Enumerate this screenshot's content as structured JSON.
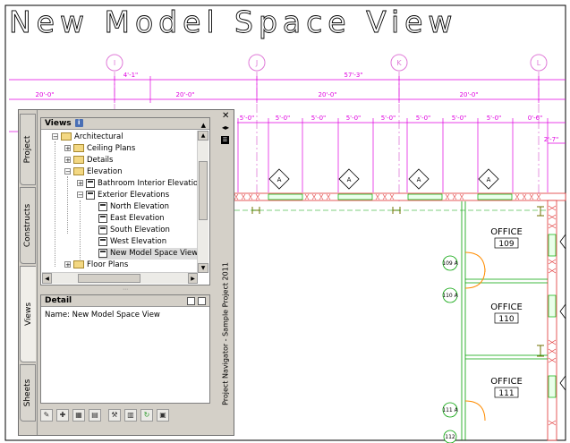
{
  "drawing": {
    "view_title": "New Model Space View",
    "grid_bubbles": [
      "I",
      "J",
      "K",
      "L"
    ],
    "dimensions_top": [
      "4'-1\"",
      "57'-3\""
    ],
    "dimensions_mid": [
      "20'-0\"",
      "20'-0\"",
      "20'-0\"",
      "20'-0\""
    ],
    "dimensions_small": [
      "5'-0\"",
      "5'-0\"",
      "5'-0\"",
      "5'-0\"",
      "5'-0\"",
      "5'-0\"",
      "5'-0\"",
      "5'-0\"",
      "5'-0\"",
      "5'-0\"",
      "5'-0\"",
      "5'-0\"",
      "0'-6\""
    ],
    "dimension_right": "2'-7\"",
    "window_tags": [
      "A",
      "A",
      "A",
      "A"
    ],
    "rooms": [
      {
        "name": "OFFICE",
        "number": "109"
      },
      {
        "name": "OFFICE",
        "number": "110"
      },
      {
        "name": "OFFICE",
        "number": "111"
      }
    ],
    "door_tags": [
      "109 A",
      "110 A",
      "111 A",
      "112"
    ],
    "colors": {
      "dimension": "#e000e0",
      "grid": "#e07ad8",
      "wall": "#e03030",
      "window": "#00b000",
      "door": "#ff8c00"
    }
  },
  "palette": {
    "title": "Project Navigator - Sample Project 2011",
    "tabs": [
      "Project",
      "Constructs",
      "Views",
      "Sheets"
    ],
    "active_tab": "Views",
    "views_header": "Views",
    "info_icon": "i",
    "tree": [
      {
        "label": "Architectural",
        "type": "open-folder"
      },
      {
        "label": "Ceiling Plans",
        "type": "folder"
      },
      {
        "label": "Details",
        "type": "folder"
      },
      {
        "label": "Elevation",
        "type": "open-folder"
      },
      {
        "label": "Bathroom Interior Elevations",
        "type": "view-folder"
      },
      {
        "label": "Exterior Elevations",
        "type": "view-folder"
      },
      {
        "label": "North Elevation",
        "type": "view"
      },
      {
        "label": "East Elevation",
        "type": "view"
      },
      {
        "label": "South Elevation",
        "type": "view"
      },
      {
        "label": "West Elevation",
        "type": "view"
      },
      {
        "label": "New Model Space View",
        "type": "view",
        "selected": true
      },
      {
        "label": "Floor Plans",
        "type": "folder"
      }
    ],
    "detail_header": "Detail",
    "detail_name": "Name: New Model Space View",
    "toolbar_icons": [
      "new-view-icon",
      "new-detail-view-icon",
      "new-section-view-icon",
      "new-elevation-view-icon",
      "regenerate-views-icon",
      "repath-project-icon",
      "refresh-icon",
      "reports-icon"
    ]
  }
}
